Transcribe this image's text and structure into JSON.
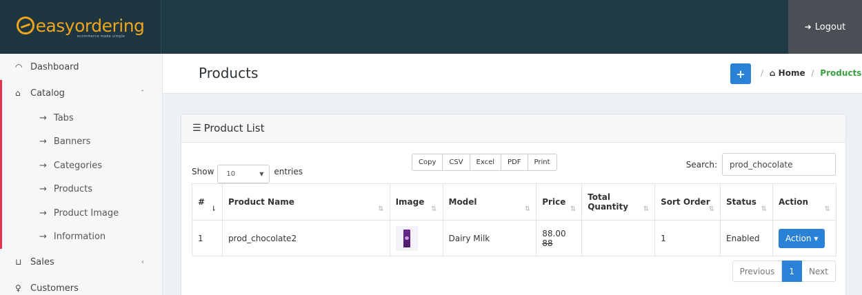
{
  "brand": {
    "name": "easyordering",
    "tagline": "ecommerce made simple",
    "accent_color": "#f0a51e"
  },
  "header": {
    "logout_icon": "sign-out-icon",
    "logout_label": "Logout"
  },
  "sidebar": {
    "items": [
      {
        "label": "Dashboard",
        "icon": "dashboard-icon"
      },
      {
        "label": "Catalog",
        "icon": "tag-icon",
        "caret": "˅"
      },
      {
        "label": "Sales",
        "icon": "cart-icon",
        "caret": "‹"
      },
      {
        "label": "Customers",
        "icon": "user-icon"
      }
    ],
    "catalog_children": [
      {
        "label": "Tabs"
      },
      {
        "label": "Banners"
      },
      {
        "label": "Categories"
      },
      {
        "label": "Products"
      },
      {
        "label": "Product Image"
      },
      {
        "label": "Information"
      }
    ],
    "active_color": "#e3324a"
  },
  "page": {
    "title": "Products",
    "add_label": "+",
    "breadcrumb": {
      "home": "Home",
      "current": "Products"
    }
  },
  "panel": {
    "title": "Product List",
    "show_label": "Show",
    "entries_value": "10",
    "entries_label": "entries",
    "export_buttons": [
      "Copy",
      "CSV",
      "Excel",
      "PDF",
      "Print"
    ],
    "search_label": "Search:",
    "search_value": "prod_chocolate"
  },
  "table": {
    "headers": [
      "#",
      "Product Name",
      "Image",
      "Model",
      "Price",
      "Total Quantity",
      "Sort Order",
      "Status",
      "Action"
    ],
    "rows": [
      {
        "num": "1",
        "name": "prod_chocolate2",
        "model": "Dairy Milk",
        "price": "88.00",
        "price_old": "88",
        "quantity": "",
        "sort_order": "1",
        "status": "Enabled",
        "action": "Action ▾"
      }
    ]
  },
  "pagination": {
    "previous": "Previous",
    "current": "1",
    "next": "Next"
  }
}
